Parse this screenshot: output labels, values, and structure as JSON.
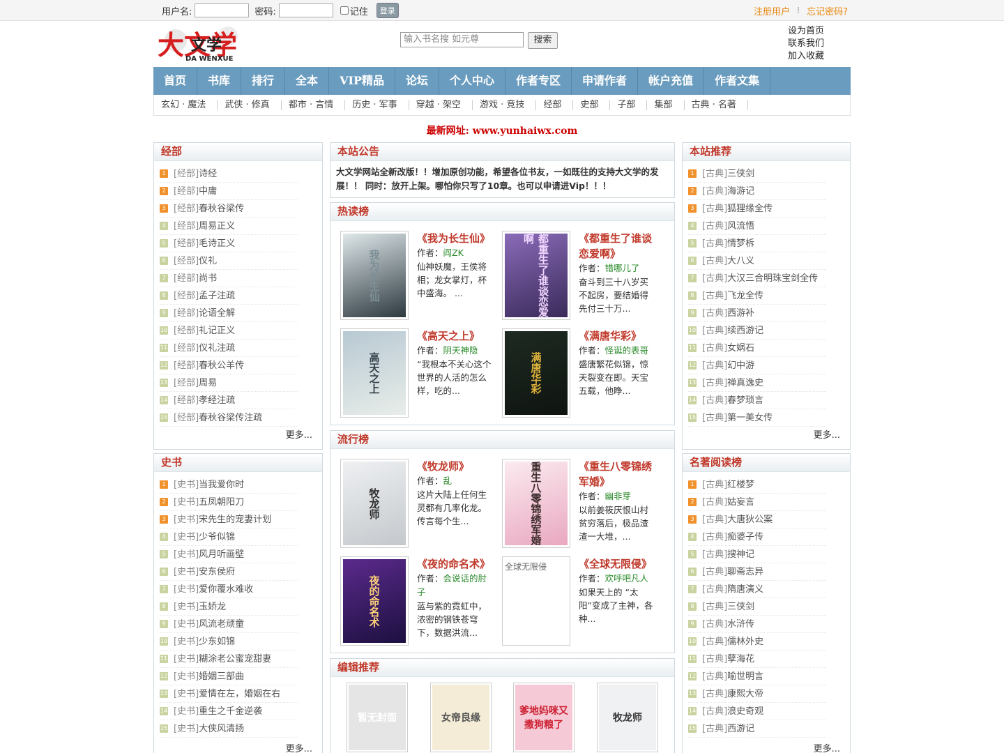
{
  "topbar": {
    "username_label": "用户名:",
    "password_label": "密码:",
    "remember_label": "记住",
    "login_label": "登录",
    "register": "注册用户",
    "forgot": "忘记密码?",
    "sep": "⁞"
  },
  "header": {
    "logo_cn": "大文学",
    "logo_en": "DA WENXUE",
    "search_placeholder": "输入书名搜 如元尊",
    "search_button": "搜索",
    "links": [
      "设为首页",
      "联系我们",
      "加入收藏"
    ]
  },
  "nav": [
    "首页",
    "书库",
    "排行",
    "全本",
    "VIP精品",
    "论坛",
    "个人中心",
    "作者专区",
    "申请作者",
    "帐户充值",
    "作者文集"
  ],
  "subnav": [
    "玄幻 · 魔法",
    "武侠 · 修真",
    "都市 · 言情",
    "历史 · 军事",
    "穿越 · 架空",
    "游戏 · 竞技",
    "经部",
    "史部",
    "子部",
    "集部",
    "古典 · 名著"
  ],
  "newurl": "最新网址: www.yunhaiwx.com",
  "left1": {
    "title": "经部",
    "cat": "[经部]",
    "items": [
      "诗经",
      "中庸",
      "春秋谷梁传",
      "周易正义",
      "毛诗正义",
      "仪礼",
      "尚书",
      "孟子注疏",
      "论语全解",
      "礼记正义",
      "仪礼注疏",
      "春秋公羊传",
      "周易",
      "孝经注疏",
      "春秋谷梁传注疏"
    ],
    "more": "更多..."
  },
  "left2": {
    "title": "史书",
    "cat": "[史书]",
    "items": [
      "当我爱你时",
      "五凤朝阳刀",
      "宋先生的宠妻计划",
      "少爷似锦",
      "风月听画壁",
      "安东侯府",
      "爱你覆水难收",
      "玉娇龙",
      "风流老顽童",
      "少东如锦",
      "糊涂老公蜜宠甜妻",
      "婚姻三部曲",
      "爱情在左，婚姻在右",
      "重生之千金逆袭",
      "大侠风清扬"
    ],
    "more": "更多..."
  },
  "right1": {
    "title": "本站推荐",
    "cat": "[古典]",
    "items": [
      "三侠剑",
      "海游记",
      "狐狸缘全传",
      "风流悟",
      "情梦柝",
      "大八义",
      "大汉三合明珠宝剑全传",
      "飞龙全传",
      "西游补",
      "续西游记",
      "女娲石",
      "幻中游",
      "禅真逸史",
      "春梦琐言",
      "第一美女传"
    ],
    "more": "更多..."
  },
  "right2": {
    "title": "名著阅读榜",
    "cat": "[古典]",
    "items": [
      "红楼梦",
      "姑妄言",
      "大唐狄公案",
      "痴婆子传",
      "搜神记",
      "聊斋志异",
      "隋唐演义",
      "三侠剑",
      "水浒传",
      "儒林外史",
      "孽海花",
      "喻世明言",
      "康熙大帝",
      "浪史奇观",
      "西游记"
    ],
    "more": "更多..."
  },
  "notice": {
    "title": "本站公告",
    "text": "大文学网站全新改版！！增加原创功能，希望各位书友，一如既往的支持大文学的发展！！ 同时：放开上架。哪怕你只写了10章。也可以申请进Vip！！！"
  },
  "hot": {
    "title": "热读榜",
    "author_label": "作者：",
    "books": [
      {
        "title": "《我为长生仙》",
        "author": "阎ZK",
        "desc": "仙神妖魔，王侯将相；龙女掌灯，杯中盛海。 ...",
        "cover_text": "我为长生仙"
      },
      {
        "title": "《都重生了谁谈恋爱啊》",
        "author": "错哪儿了",
        "desc": "奋斗到三十八岁买不起房，要结婚得先付三十万...",
        "cover_text": "都重生了谁谈恋爱啊"
      },
      {
        "title": "《高天之上》",
        "author": "阴天神隐",
        "desc": "“我根本不关心这个世界的人活的怎么样，吃的...",
        "cover_text": "高天之上"
      },
      {
        "title": "《满唐华彩》",
        "author": "怪诞的表哥",
        "desc": "盛唐繁花似锦，惊天裂变在即。天宝五载，他睁...",
        "cover_text": "满唐华彩"
      }
    ]
  },
  "popular": {
    "title": "流行榜",
    "author_label": "作者：",
    "books": [
      {
        "title": "《牧龙师》",
        "author": "乱",
        "desc": "这片大陆上任何生灵都有几率化龙。传言每个生...",
        "cover_text": "牧龙师"
      },
      {
        "title": "《重生八零锦绣军婚》",
        "author": "幽非芽",
        "desc": "以前姜筱厌恨山村贫穷落后，极品渣渣一大堆，...",
        "cover_text": "重生八零锦绣军婚"
      },
      {
        "title": "《夜的命名术》",
        "author": "会说话的肘子",
        "desc": "蓝与紫的霓虹中，浓密的钢铁苍穹下，数据洪流...",
        "cover_text": "夜的命名术"
      },
      {
        "title": "《全球无限侵》",
        "author": "欢呼吧凡人",
        "desc": "如果天上的 “太阳”变成了主神，各种...",
        "cover_text": "全球无限侵"
      }
    ]
  },
  "editor": {
    "title": "编辑推荐",
    "covers": [
      "暂无封面",
      "女帝良缘",
      "爹地妈咪又撒狗粮了",
      "牧龙师"
    ]
  }
}
